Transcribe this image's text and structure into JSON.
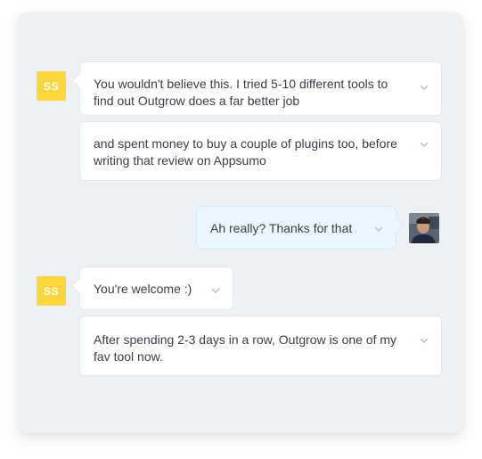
{
  "chat": {
    "messages": [
      {
        "sender": "SS",
        "text": "You wouldn't believe this. I tried 5-10 different tools to find out Outgrow does a far better job"
      },
      {
        "sender": "SS",
        "text": "and spent money to buy a couple of plugins too, before writing that review on Appsumo"
      },
      {
        "sender": "me",
        "text": "Ah really? Thanks for that"
      },
      {
        "sender": "SS",
        "text": "You're welcome :)"
      },
      {
        "sender": "SS",
        "text": "After spending 2-3 days in a row, Outgrow is one of my fav tool now."
      }
    ]
  },
  "avatars": {
    "other_initials": "SS",
    "other_color": "#fbd63a",
    "me_avatar": "user-photo-icon"
  },
  "colors": {
    "panel_bg": "#eef1f4",
    "incoming_bubble": "#ffffff",
    "outgoing_bubble": "#eaf6ff"
  }
}
